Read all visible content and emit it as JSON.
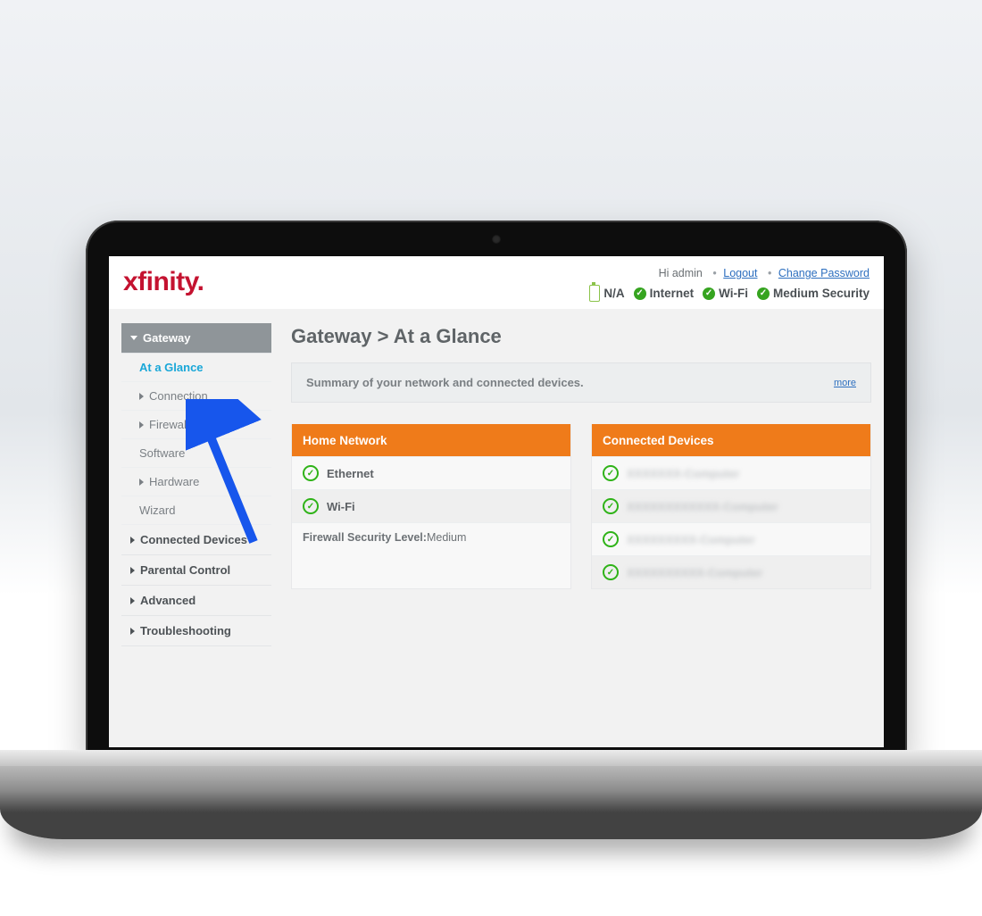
{
  "brand": "xfinity",
  "header": {
    "greeting": "Hi admin",
    "logout": "Logout",
    "change_password": "Change Password",
    "status": {
      "battery": "N/A",
      "internet": "Internet",
      "wifi": "Wi-Fi",
      "security": "Medium Security"
    }
  },
  "sidebar": {
    "gateway": "Gateway",
    "gateway_items": {
      "at_a_glance": "At a Glance",
      "connection": "Connection",
      "firewall": "Firewall",
      "software": "Software",
      "hardware": "Hardware",
      "wizard": "Wizard"
    },
    "connected_devices": "Connected Devices",
    "parental_control": "Parental Control",
    "advanced": "Advanced",
    "troubleshooting": "Troubleshooting"
  },
  "page": {
    "title": "Gateway > At a Glance",
    "summary": "Summary of your network and connected devices.",
    "more": "more"
  },
  "home_network": {
    "title": "Home Network",
    "ethernet": "Ethernet",
    "wifi": "Wi-Fi",
    "firewall_label": "Firewall Security Level:",
    "firewall_value": "Medium"
  },
  "connected_panel": {
    "title": "Connected Devices",
    "devices": [
      "XXXXXXX-Computer",
      "XXXXXXXXXXXX-Computer",
      "XXXXXXXXX-Computer",
      "XXXXXXXXXX-Computer"
    ]
  }
}
